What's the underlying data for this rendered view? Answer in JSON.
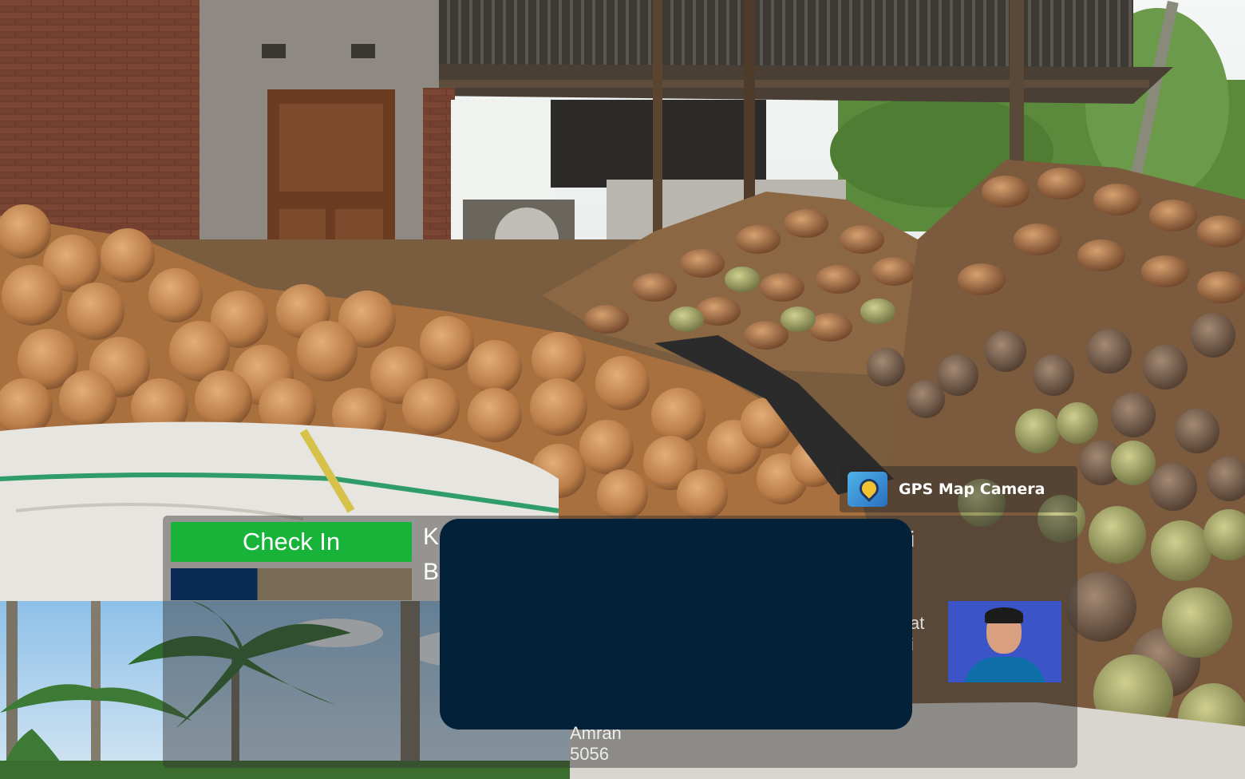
{
  "watermark": {
    "app_name": "GPS Map Camera",
    "check_in_label": "Check In",
    "partial_lines": [
      "K",
      "B",
      "i",
      "at",
      "i"
    ],
    "bottom_lines": [
      "Amran",
      "5056"
    ]
  },
  "colors": {
    "check_in_green": "#18b43a",
    "redaction_navy": "#04213a",
    "avatar_blue": "#3b55c8"
  },
  "icons": {
    "app_logo": "gps-map-pin-icon"
  }
}
